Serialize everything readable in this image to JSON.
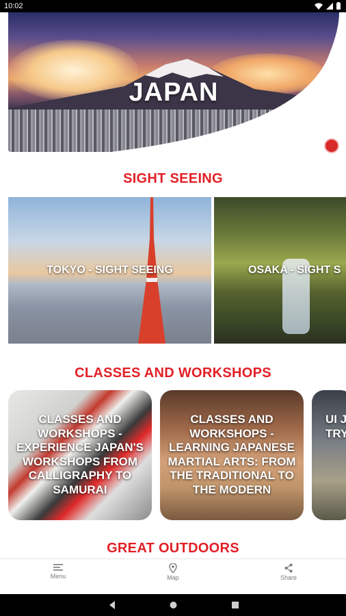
{
  "status_bar": {
    "time": "10:02"
  },
  "hero": {
    "title": "JAPAN"
  },
  "sections": {
    "sightseeing": {
      "title": "SIGHT SEEING",
      "cards": [
        {
          "label": "TOKYO - SIGHT SEEING"
        },
        {
          "label": "OSAKA - SIGHT S"
        }
      ]
    },
    "classes": {
      "title": "CLASSES AND WORKSHOPS",
      "cards": [
        {
          "label": "CLASSES AND WORKSHOPS - EXPERIENCE JAPAN'S WORKSHOPS FROM CALLIGRAPHY TO SAMURAI"
        },
        {
          "label": "CLASSES AND WORKSHOPS - LEARNING JAPANESE MARTIAL ARTS: FROM THE TRADITIONAL TO THE MODERN"
        },
        {
          "label": "UI JAP COO TRY"
        }
      ]
    },
    "outdoors": {
      "title": "GREAT OUTDOORS"
    }
  },
  "bottom_nav": [
    {
      "label": "Menu",
      "icon": "menu-icon"
    },
    {
      "label": "Map",
      "icon": "map-pin-icon"
    },
    {
      "label": "Share",
      "icon": "share-icon"
    }
  ],
  "colors": {
    "accent": "#e21f26"
  }
}
